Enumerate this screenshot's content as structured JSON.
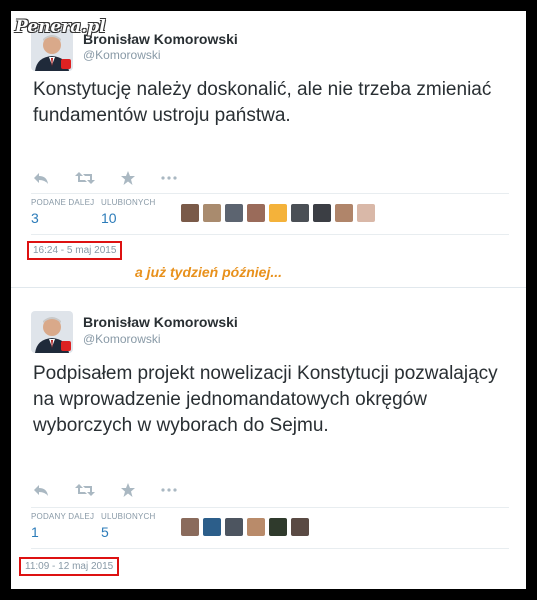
{
  "watermark": "Penera.pl",
  "separator_text": "a już tydzień później...",
  "tweets": [
    {
      "name": "Bronisław Komorowski",
      "handle": "@Komorowski",
      "text": "Konstytucję należy doskonalić, ale nie trzeba zmieniać fundamentów ustroju państwa.",
      "retweets_label": "PODANE DALEJ",
      "retweets": "3",
      "favorites_label": "ULUBIONYCH",
      "favorites": "10",
      "timestamp": "16:24 - 5 maj 2015",
      "favoriter_colors": [
        "#7a5a48",
        "#a98b6e",
        "#5c6470",
        "#9a6b5a",
        "#f4b23a",
        "#4a4f55",
        "#3b3e44",
        "#b0856a",
        "#d9b8a8"
      ]
    },
    {
      "name": "Bronisław Komorowski",
      "handle": "@Komorowski",
      "text": "Podpisałem projekt nowelizacji Konstytucji pozwalający na wprowadzenie jednomandatowych okręgów wyborczych w wyborach do Sejmu.",
      "retweets_label": "PODANY DALEJ",
      "retweets": "1",
      "favorites_label": "ULUBIONYCH",
      "favorites": "5",
      "timestamp": "11:09 - 12 maj 2015",
      "favoriter_colors": [
        "#8a6b5c",
        "#2c5e8a",
        "#4d5560",
        "#b98b6a",
        "#2f3a2c",
        "#5a4a44"
      ]
    }
  ],
  "colors": {
    "link_blue": "#2b7bb9",
    "muted": "#8899a6",
    "highlight_red": "#dd1111",
    "orange": "#e8911c"
  }
}
